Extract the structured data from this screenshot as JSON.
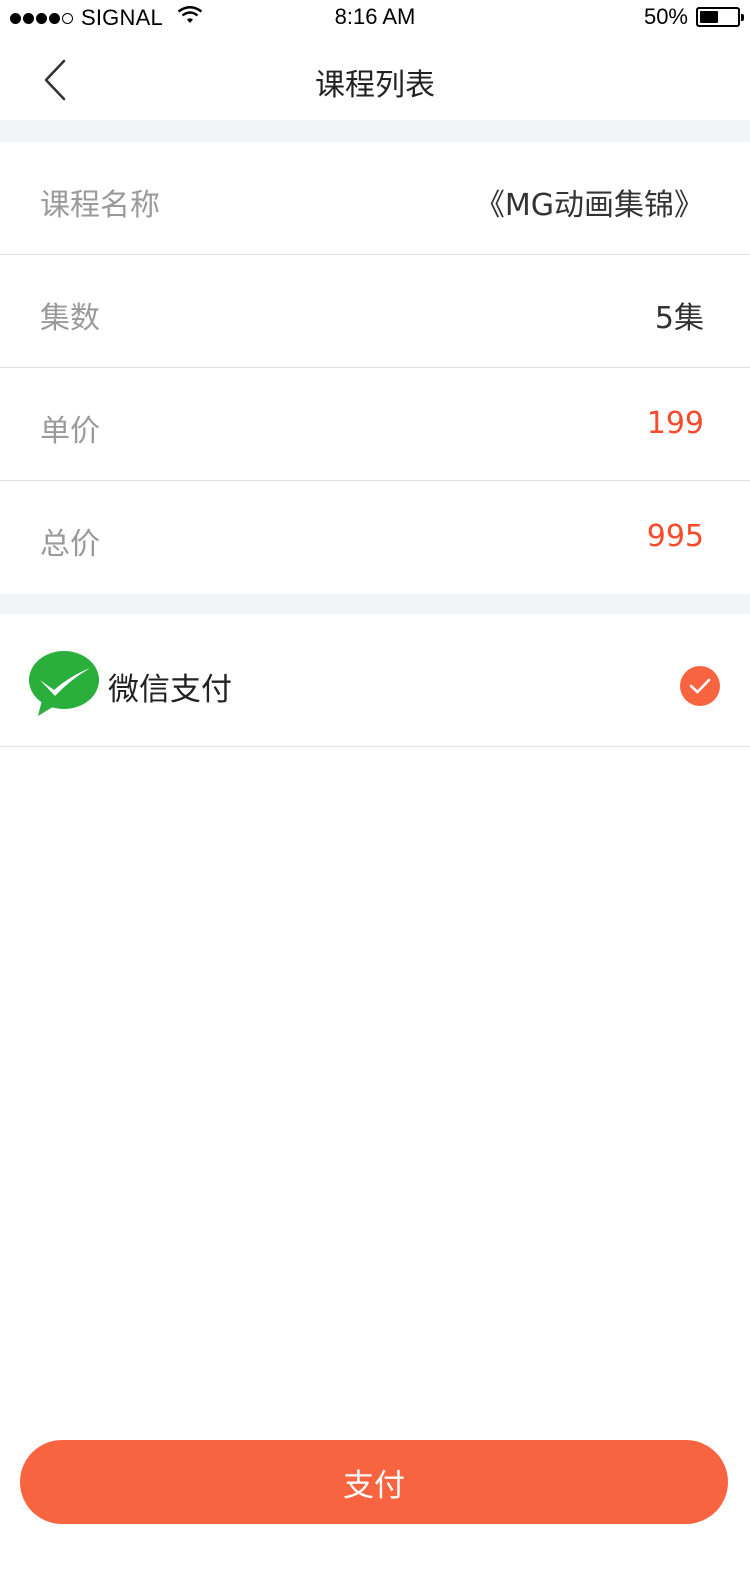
{
  "status_bar": {
    "carrier": "SIGNAL",
    "time": "8:16 AM",
    "battery_percent": "50%",
    "battery_level": 0.5,
    "signal_bars_filled": 4,
    "signal_bars_total": 5
  },
  "nav": {
    "title": "课程列表",
    "back_icon": "chevron-left-icon"
  },
  "details": {
    "rows": [
      {
        "label": "课程名称",
        "value": "《MG动画集锦》"
      },
      {
        "label": "集数",
        "value": "5集"
      },
      {
        "label": "单价",
        "value": "199"
      },
      {
        "label": "总价",
        "value": "995"
      }
    ]
  },
  "payment": {
    "method_label": "微信支付",
    "method_icon": "wechat-pay-icon",
    "selected": true
  },
  "actions": {
    "pay_label": "支付"
  },
  "colors": {
    "accent": "#f86440",
    "price": "#f74b2c",
    "wechat_green": "#2aae3c",
    "separator_bg": "#f2f3f5"
  }
}
